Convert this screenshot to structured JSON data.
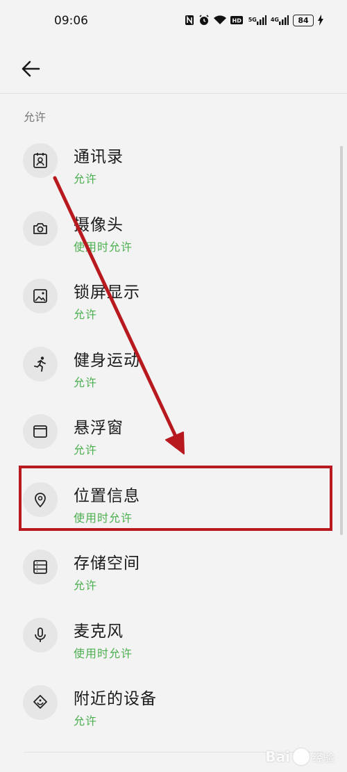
{
  "status_bar": {
    "time": "09:06",
    "net1": "5G",
    "net2": "4G",
    "battery": "84"
  },
  "section": {
    "title": "允许"
  },
  "accent_color": "#4caf50",
  "annotation_color": "#b8191e",
  "items": [
    {
      "name": "通讯录",
      "status": "允许",
      "icon": "contacts-icon"
    },
    {
      "name": "摄像头",
      "status": "使用时允许",
      "icon": "camera-icon"
    },
    {
      "name": "锁屏显示",
      "status": "允许",
      "icon": "lockscreen-image-icon"
    },
    {
      "name": "健身运动",
      "status": "允许",
      "icon": "running-icon"
    },
    {
      "name": "悬浮窗",
      "status": "允许",
      "icon": "floating-window-icon"
    },
    {
      "name": "位置信息",
      "status": "使用时允许",
      "icon": "location-pin-icon"
    },
    {
      "name": "存储空间",
      "status": "允许",
      "icon": "storage-icon"
    },
    {
      "name": "麦克风",
      "status": "使用时允许",
      "icon": "microphone-icon"
    },
    {
      "name": "附近的设备",
      "status": "允许",
      "icon": "nearby-devices-icon"
    }
  ],
  "watermark": {
    "text": "Bai",
    "sub": "经验"
  }
}
